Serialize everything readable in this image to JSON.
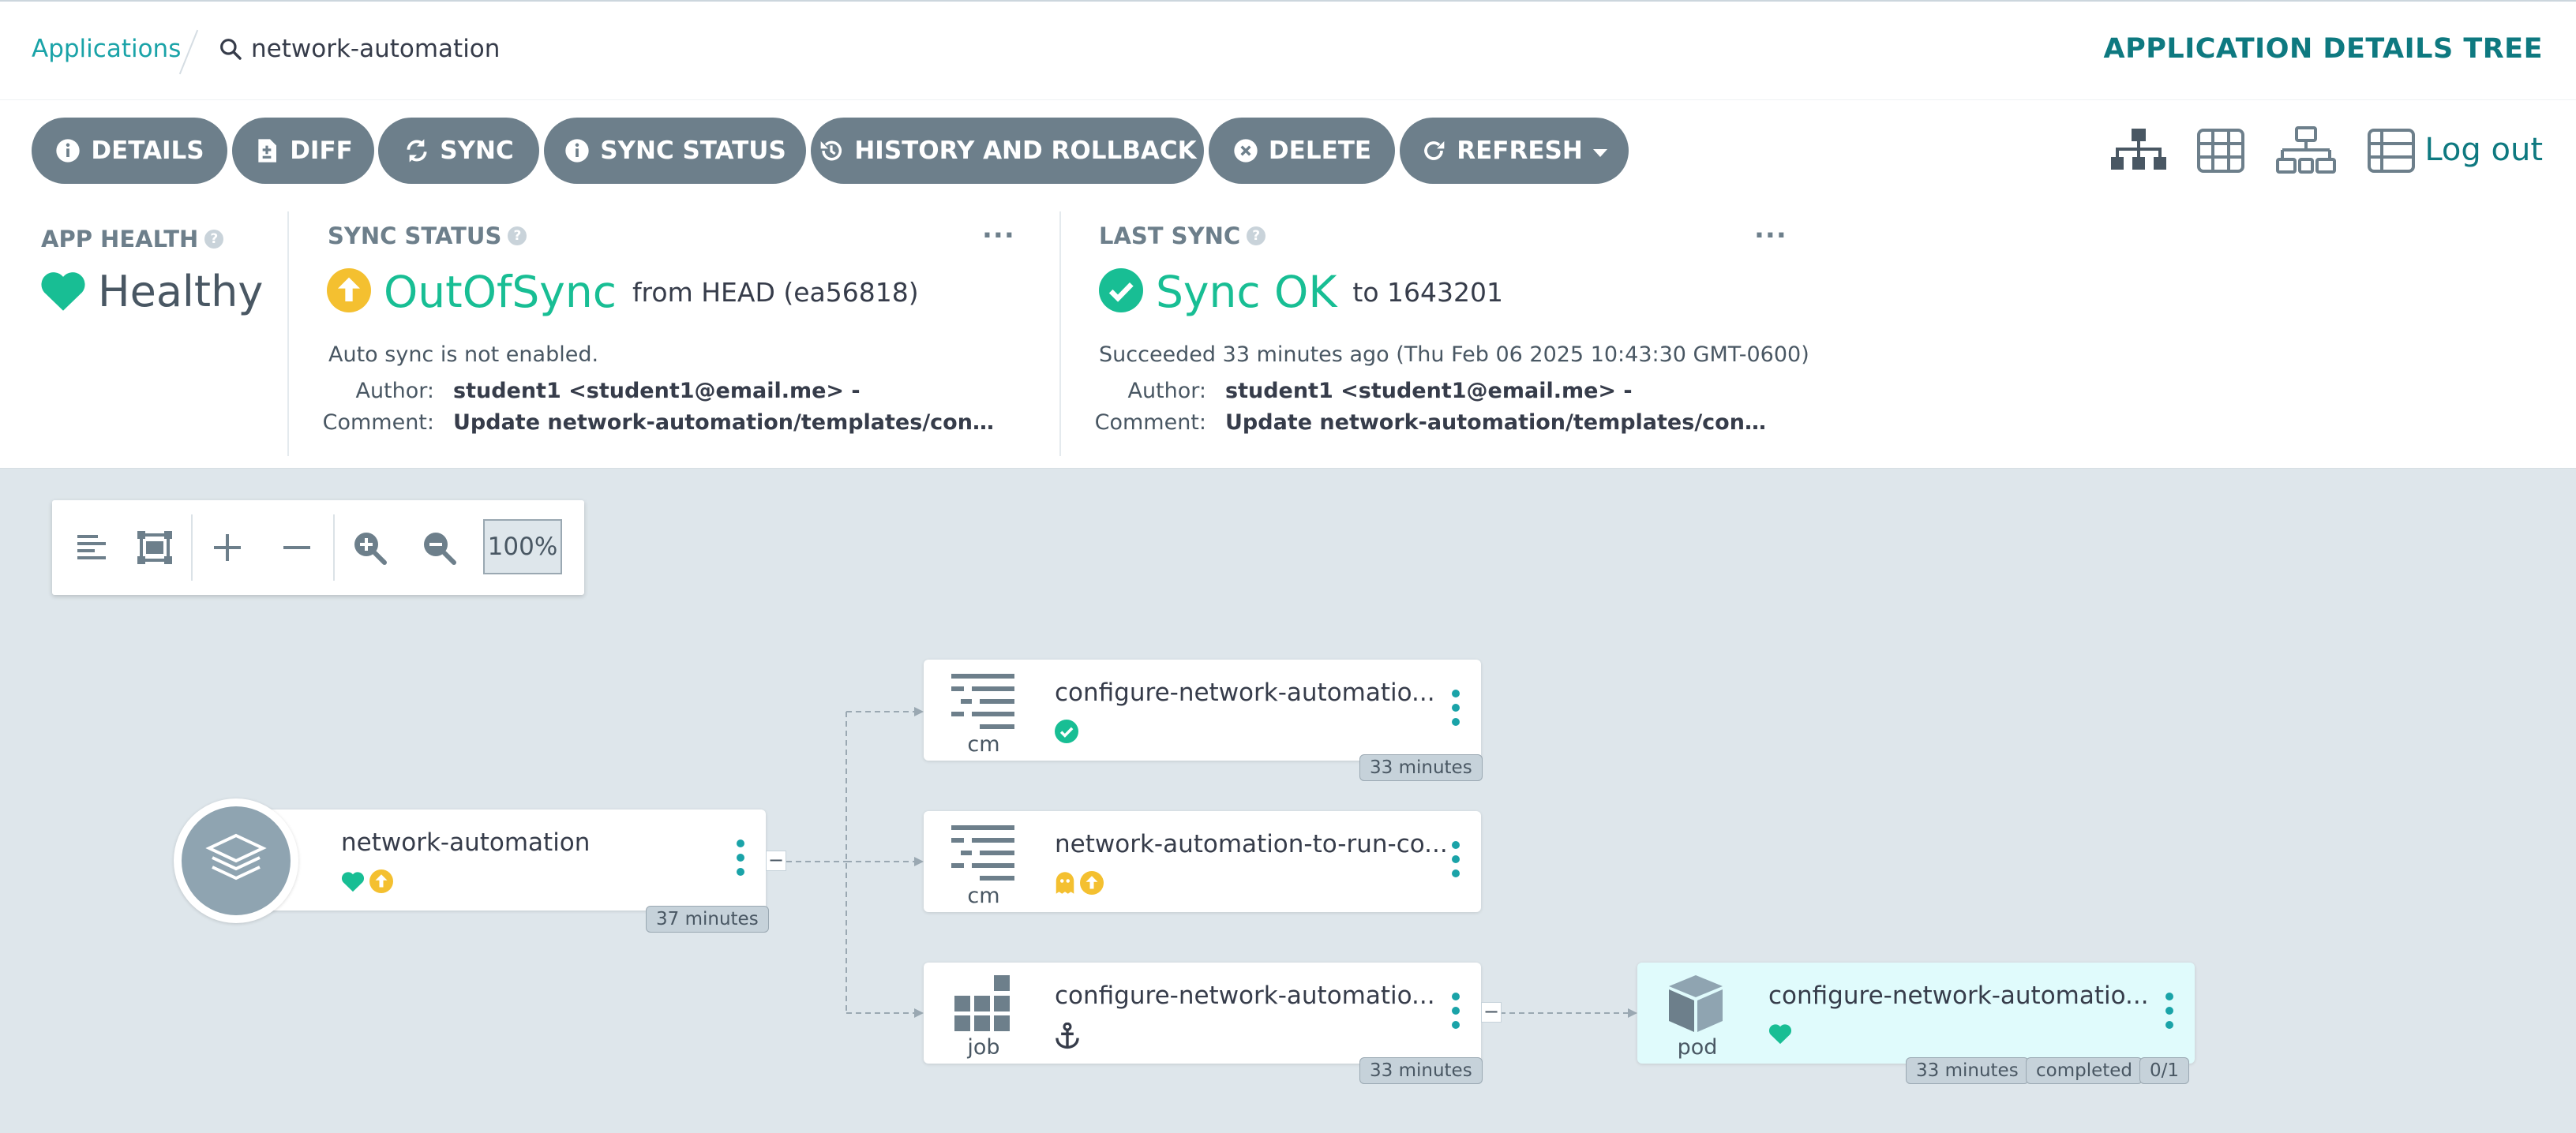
{
  "breadcrumb": {
    "applications": "Applications",
    "search_text": "network-automation"
  },
  "page_heading": "APPLICATION DETAILS TREE",
  "toolbar": {
    "details": "DETAILS",
    "diff": "DIFF",
    "sync": "SYNC",
    "sync_status": "SYNC STATUS",
    "history": "HISTORY AND ROLLBACK",
    "delete": "DELETE",
    "refresh": "REFRESH",
    "logout": "Log out"
  },
  "app_health": {
    "title": "APP HEALTH",
    "value": "Healthy"
  },
  "sync_status": {
    "title": "SYNC STATUS",
    "value": "OutOfSync",
    "from": "from HEAD (ea56818)",
    "auto_sync": "Auto sync is not enabled.",
    "author_label": "Author:",
    "author": "student1 <student1@email.me> -",
    "comment_label": "Comment:",
    "comment": "Update network-automation/templates/configmap.yaml"
  },
  "last_sync": {
    "title": "LAST SYNC",
    "value": "Sync OK",
    "to": "to 1643201",
    "succeeded": "Succeeded 33 minutes ago (Thu Feb 06 2025 10:43:30 GMT-0600)",
    "author_label": "Author:",
    "author": "student1 <student1@email.me> -",
    "comment_label": "Comment:",
    "comment": "Update network-automation/templates/configmap.yaml"
  },
  "more_icon": "...",
  "zoom": {
    "level": "100%"
  },
  "root_node": {
    "name": "network-automation",
    "age": "37 minutes"
  },
  "nodes": [
    {
      "kind": "cm",
      "name": "configure-network-automatio...",
      "age": "33 minutes"
    },
    {
      "kind": "cm",
      "name": "network-automation-to-run-co..."
    },
    {
      "kind": "job",
      "name": "configure-network-automatio...",
      "age": "33 minutes"
    },
    {
      "kind": "pod",
      "name": "configure-network-automatio...",
      "age": "33 minutes",
      "status": "completed",
      "ready": "0/1"
    }
  ],
  "colors": {
    "teal": "#1aa3a8",
    "healthy": "#18be94",
    "outofsync": "#f4c030",
    "button": "#6d7f8b"
  }
}
